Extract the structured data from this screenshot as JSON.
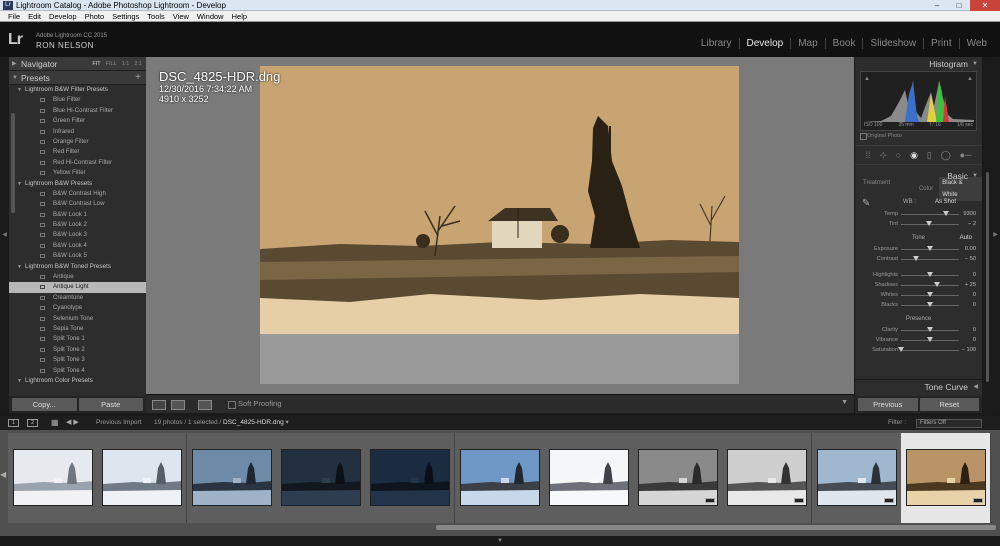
{
  "window": {
    "title": "Lightroom Catalog - Adobe Photoshop Lightroom - Develop",
    "buttons": {
      "minimize": "–",
      "maximize": "□",
      "close": "✕"
    }
  },
  "menu": [
    "File",
    "Edit",
    "Develop",
    "Photo",
    "Settings",
    "Tools",
    "View",
    "Window",
    "Help"
  ],
  "identity": {
    "logo": "Lr",
    "version": "Adobe Lightroom CC 2015",
    "user": "RON NELSON",
    "modules": [
      "Library",
      "Develop",
      "Map",
      "Book",
      "Slideshow",
      "Print",
      "Web"
    ],
    "active_module": "Develop"
  },
  "left_panel": {
    "navigator": {
      "title": "Navigator",
      "zoom": [
        "FIT",
        "FILL",
        "1:1",
        "2:1"
      ],
      "active_zoom": "FIT"
    },
    "presets": {
      "title": "Presets",
      "add": "+",
      "rows": [
        {
          "kind": "folder",
          "label": "Lightroom B&W Filter Presets"
        },
        {
          "kind": "preset",
          "label": "Blue Filter"
        },
        {
          "kind": "preset",
          "label": "Blue Hi-Contrast Filter"
        },
        {
          "kind": "preset",
          "label": "Green Filter"
        },
        {
          "kind": "preset",
          "label": "Infrared"
        },
        {
          "kind": "preset",
          "label": "Orange Filter"
        },
        {
          "kind": "preset",
          "label": "Red Filter"
        },
        {
          "kind": "preset",
          "label": "Red Hi-Contrast Filter"
        },
        {
          "kind": "preset",
          "label": "Yellow Filter"
        },
        {
          "kind": "folder",
          "label": "Lightroom B&W Presets"
        },
        {
          "kind": "preset",
          "label": "B&W Contrast High"
        },
        {
          "kind": "preset",
          "label": "B&W Contrast Low"
        },
        {
          "kind": "preset",
          "label": "B&W Look 1"
        },
        {
          "kind": "preset",
          "label": "B&W Look 2"
        },
        {
          "kind": "preset",
          "label": "B&W Look 3"
        },
        {
          "kind": "preset",
          "label": "B&W Look 4"
        },
        {
          "kind": "preset",
          "label": "B&W Look 5"
        },
        {
          "kind": "folder",
          "label": "Lightroom B&W Toned Presets"
        },
        {
          "kind": "preset",
          "label": "Antique"
        },
        {
          "kind": "preset",
          "label": "Antique Light",
          "selected": true
        },
        {
          "kind": "preset",
          "label": "Creamtone"
        },
        {
          "kind": "preset",
          "label": "Cyanotype"
        },
        {
          "kind": "preset",
          "label": "Selenium Tone"
        },
        {
          "kind": "preset",
          "label": "Sepia Tone"
        },
        {
          "kind": "preset",
          "label": "Split Tone 1"
        },
        {
          "kind": "preset",
          "label": "Split Tone 2"
        },
        {
          "kind": "preset",
          "label": "Split Tone 3"
        },
        {
          "kind": "preset",
          "label": "Split Tone 4"
        },
        {
          "kind": "folder",
          "label": "Lightroom Color Presets"
        }
      ]
    },
    "copy_label": "Copy...",
    "paste_label": "Paste"
  },
  "photo_info": {
    "filename": "DSC_4825-HDR.dng",
    "datetime": "12/30/2016 7:34:22 AM",
    "dimensions": "4910 x 3252"
  },
  "toolbar": {
    "soft_proofing": "Soft Proofing"
  },
  "right_panel": {
    "histogram": {
      "title": "Histogram",
      "iso": "ISO 100",
      "focal": "35 mm",
      "aperture": "f / 16",
      "shutter": "1/6 sec",
      "original_photo": "Original Photo"
    },
    "basic": {
      "title": "Basic",
      "treatment_label": "Treatment :",
      "treatment_color": "Color",
      "treatment_bw": "Black & White",
      "wb_label": "WB :",
      "wb_value": "As Shot",
      "wb_rows": [
        {
          "label": "Temp",
          "value": "9300",
          "pos": 0.78
        },
        {
          "label": "Tint",
          "value": "− 2",
          "pos": 0.48
        }
      ],
      "tone_label": "Tone",
      "auto_label": "Auto",
      "tone_rows": [
        {
          "label": "Exposure",
          "value": "0.00",
          "pos": 0.5
        },
        {
          "label": "Contrast",
          "value": "− 50",
          "pos": 0.25
        }
      ],
      "tone_rows2": [
        {
          "label": "Highlights",
          "value": "0",
          "pos": 0.5
        },
        {
          "label": "Shadows",
          "value": "+ 25",
          "pos": 0.62
        },
        {
          "label": "Whites",
          "value": "0",
          "pos": 0.5
        },
        {
          "label": "Blacks",
          "value": "0",
          "pos": 0.5
        }
      ],
      "presence_label": "Presence",
      "presence_rows": [
        {
          "label": "Clarity",
          "value": "0",
          "pos": 0.5
        },
        {
          "label": "Vibrance",
          "value": "0",
          "pos": 0.5
        },
        {
          "label": "Saturation",
          "value": "− 100",
          "pos": 0.0
        }
      ]
    },
    "tone_curve": "Tone Curve",
    "previous_label": "Previous",
    "reset_label": "Reset"
  },
  "filmstrip": {
    "source": "Previous Import",
    "count": "19 photos / 1 selected /",
    "filename": "DSC_4825-HDR.dng",
    "filter_label": "Filter :",
    "filter_value": "Filters Off",
    "thumbs": [
      {
        "sky": "#e6eaee",
        "mid": "#9aa3ad",
        "ground": "#f2f2f4",
        "tree": "#6f7680"
      },
      {
        "sky": "#dde6ee",
        "mid": "#6f7a85",
        "ground": "#eef2f6",
        "tree": "#555d66"
      },
      {
        "sky": "#6d8aa8",
        "mid": "#2b3442",
        "ground": "#9fb2c8",
        "tree": "#1f2630"
      },
      {
        "sky": "#223040",
        "mid": "#111820",
        "ground": "#2e3d50",
        "tree": "#0c1016"
      },
      {
        "sky": "#1b2b40",
        "mid": "#0e151f",
        "ground": "#22334a",
        "tree": "#0a0f16"
      },
      {
        "sky": "#6f97c6",
        "mid": "#3b4048",
        "ground": "#c8d8ea",
        "tree": "#222830"
      },
      {
        "sky": "#f4f6f8",
        "mid": "#6d7078",
        "ground": "#f7f8fa",
        "tree": "#3e4247"
      },
      {
        "sky": "#8a8a8a",
        "mid": "#3a3a3a",
        "ground": "#d6d6d6",
        "tree": "#2a2a2a",
        "badge": true
      },
      {
        "sky": "#cfcfcf",
        "mid": "#555555",
        "ground": "#e8e8e8",
        "tree": "#333333",
        "badge": true
      },
      {
        "sky": "#9fb7cf",
        "mid": "#454c55",
        "ground": "#dfe6ee",
        "tree": "#2c3138",
        "badge": true
      },
      {
        "sky": "#b89466",
        "mid": "#4a3820",
        "ground": "#e8d2a8",
        "tree": "#2c2012",
        "badge": true,
        "selected": true
      }
    ]
  },
  "colors": {
    "accent_bg": "#2d2d2d",
    "sepia": "#c9a473"
  }
}
